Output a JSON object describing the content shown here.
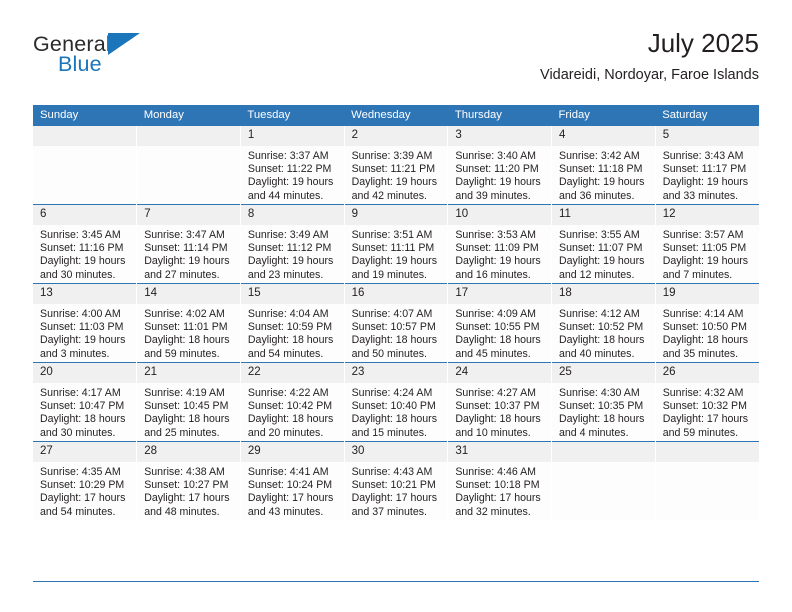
{
  "brand": {
    "name_part1": "General",
    "name_part2": "Blue",
    "triangle_color": "#1b75bb"
  },
  "header": {
    "title": "July 2025",
    "subtitle": "Vidareidi, Nordoyar, Faroe Islands"
  },
  "theme": {
    "header_bg": "#2e75b6",
    "header_text": "#ffffff",
    "daynum_bg": "#f0f0f0",
    "cell_bg": "#fdfdfd",
    "rule_color": "#2e75b6",
    "text": "#231f20"
  },
  "weekdays": [
    "Sunday",
    "Monday",
    "Tuesday",
    "Wednesday",
    "Thursday",
    "Friday",
    "Saturday"
  ],
  "labels": {
    "sunrise": "Sunrise:",
    "sunset": "Sunset:",
    "daylight": "Daylight:"
  },
  "weeks": [
    [
      {
        "day": "",
        "blank": true
      },
      {
        "day": "",
        "blank": true
      },
      {
        "day": "1",
        "sunrise": "Sunrise: 3:37 AM",
        "sunset": "Sunset: 11:22 PM",
        "daylight1": "Daylight: 19 hours",
        "daylight2": "and 44 minutes."
      },
      {
        "day": "2",
        "sunrise": "Sunrise: 3:39 AM",
        "sunset": "Sunset: 11:21 PM",
        "daylight1": "Daylight: 19 hours",
        "daylight2": "and 42 minutes."
      },
      {
        "day": "3",
        "sunrise": "Sunrise: 3:40 AM",
        "sunset": "Sunset: 11:20 PM",
        "daylight1": "Daylight: 19 hours",
        "daylight2": "and 39 minutes."
      },
      {
        "day": "4",
        "sunrise": "Sunrise: 3:42 AM",
        "sunset": "Sunset: 11:18 PM",
        "daylight1": "Daylight: 19 hours",
        "daylight2": "and 36 minutes."
      },
      {
        "day": "5",
        "sunrise": "Sunrise: 3:43 AM",
        "sunset": "Sunset: 11:17 PM",
        "daylight1": "Daylight: 19 hours",
        "daylight2": "and 33 minutes."
      }
    ],
    [
      {
        "day": "6",
        "sunrise": "Sunrise: 3:45 AM",
        "sunset": "Sunset: 11:16 PM",
        "daylight1": "Daylight: 19 hours",
        "daylight2": "and 30 minutes."
      },
      {
        "day": "7",
        "sunrise": "Sunrise: 3:47 AM",
        "sunset": "Sunset: 11:14 PM",
        "daylight1": "Daylight: 19 hours",
        "daylight2": "and 27 minutes."
      },
      {
        "day": "8",
        "sunrise": "Sunrise: 3:49 AM",
        "sunset": "Sunset: 11:12 PM",
        "daylight1": "Daylight: 19 hours",
        "daylight2": "and 23 minutes."
      },
      {
        "day": "9",
        "sunrise": "Sunrise: 3:51 AM",
        "sunset": "Sunset: 11:11 PM",
        "daylight1": "Daylight: 19 hours",
        "daylight2": "and 19 minutes."
      },
      {
        "day": "10",
        "sunrise": "Sunrise: 3:53 AM",
        "sunset": "Sunset: 11:09 PM",
        "daylight1": "Daylight: 19 hours",
        "daylight2": "and 16 minutes."
      },
      {
        "day": "11",
        "sunrise": "Sunrise: 3:55 AM",
        "sunset": "Sunset: 11:07 PM",
        "daylight1": "Daylight: 19 hours",
        "daylight2": "and 12 minutes."
      },
      {
        "day": "12",
        "sunrise": "Sunrise: 3:57 AM",
        "sunset": "Sunset: 11:05 PM",
        "daylight1": "Daylight: 19 hours",
        "daylight2": "and 7 minutes."
      }
    ],
    [
      {
        "day": "13",
        "sunrise": "Sunrise: 4:00 AM",
        "sunset": "Sunset: 11:03 PM",
        "daylight1": "Daylight: 19 hours",
        "daylight2": "and 3 minutes."
      },
      {
        "day": "14",
        "sunrise": "Sunrise: 4:02 AM",
        "sunset": "Sunset: 11:01 PM",
        "daylight1": "Daylight: 18 hours",
        "daylight2": "and 59 minutes."
      },
      {
        "day": "15",
        "sunrise": "Sunrise: 4:04 AM",
        "sunset": "Sunset: 10:59 PM",
        "daylight1": "Daylight: 18 hours",
        "daylight2": "and 54 minutes."
      },
      {
        "day": "16",
        "sunrise": "Sunrise: 4:07 AM",
        "sunset": "Sunset: 10:57 PM",
        "daylight1": "Daylight: 18 hours",
        "daylight2": "and 50 minutes."
      },
      {
        "day": "17",
        "sunrise": "Sunrise: 4:09 AM",
        "sunset": "Sunset: 10:55 PM",
        "daylight1": "Daylight: 18 hours",
        "daylight2": "and 45 minutes."
      },
      {
        "day": "18",
        "sunrise": "Sunrise: 4:12 AM",
        "sunset": "Sunset: 10:52 PM",
        "daylight1": "Daylight: 18 hours",
        "daylight2": "and 40 minutes."
      },
      {
        "day": "19",
        "sunrise": "Sunrise: 4:14 AM",
        "sunset": "Sunset: 10:50 PM",
        "daylight1": "Daylight: 18 hours",
        "daylight2": "and 35 minutes."
      }
    ],
    [
      {
        "day": "20",
        "sunrise": "Sunrise: 4:17 AM",
        "sunset": "Sunset: 10:47 PM",
        "daylight1": "Daylight: 18 hours",
        "daylight2": "and 30 minutes."
      },
      {
        "day": "21",
        "sunrise": "Sunrise: 4:19 AM",
        "sunset": "Sunset: 10:45 PM",
        "daylight1": "Daylight: 18 hours",
        "daylight2": "and 25 minutes."
      },
      {
        "day": "22",
        "sunrise": "Sunrise: 4:22 AM",
        "sunset": "Sunset: 10:42 PM",
        "daylight1": "Daylight: 18 hours",
        "daylight2": "and 20 minutes."
      },
      {
        "day": "23",
        "sunrise": "Sunrise: 4:24 AM",
        "sunset": "Sunset: 10:40 PM",
        "daylight1": "Daylight: 18 hours",
        "daylight2": "and 15 minutes."
      },
      {
        "day": "24",
        "sunrise": "Sunrise: 4:27 AM",
        "sunset": "Sunset: 10:37 PM",
        "daylight1": "Daylight: 18 hours",
        "daylight2": "and 10 minutes."
      },
      {
        "day": "25",
        "sunrise": "Sunrise: 4:30 AM",
        "sunset": "Sunset: 10:35 PM",
        "daylight1": "Daylight: 18 hours",
        "daylight2": "and 4 minutes."
      },
      {
        "day": "26",
        "sunrise": "Sunrise: 4:32 AM",
        "sunset": "Sunset: 10:32 PM",
        "daylight1": "Daylight: 17 hours",
        "daylight2": "and 59 minutes."
      }
    ],
    [
      {
        "day": "27",
        "sunrise": "Sunrise: 4:35 AM",
        "sunset": "Sunset: 10:29 PM",
        "daylight1": "Daylight: 17 hours",
        "daylight2": "and 54 minutes."
      },
      {
        "day": "28",
        "sunrise": "Sunrise: 4:38 AM",
        "sunset": "Sunset: 10:27 PM",
        "daylight1": "Daylight: 17 hours",
        "daylight2": "and 48 minutes."
      },
      {
        "day": "29",
        "sunrise": "Sunrise: 4:41 AM",
        "sunset": "Sunset: 10:24 PM",
        "daylight1": "Daylight: 17 hours",
        "daylight2": "and 43 minutes."
      },
      {
        "day": "30",
        "sunrise": "Sunrise: 4:43 AM",
        "sunset": "Sunset: 10:21 PM",
        "daylight1": "Daylight: 17 hours",
        "daylight2": "and 37 minutes."
      },
      {
        "day": "31",
        "sunrise": "Sunrise: 4:46 AM",
        "sunset": "Sunset: 10:18 PM",
        "daylight1": "Daylight: 17 hours",
        "daylight2": "and 32 minutes."
      },
      {
        "day": "",
        "blank": true
      },
      {
        "day": "",
        "blank": true
      }
    ]
  ]
}
